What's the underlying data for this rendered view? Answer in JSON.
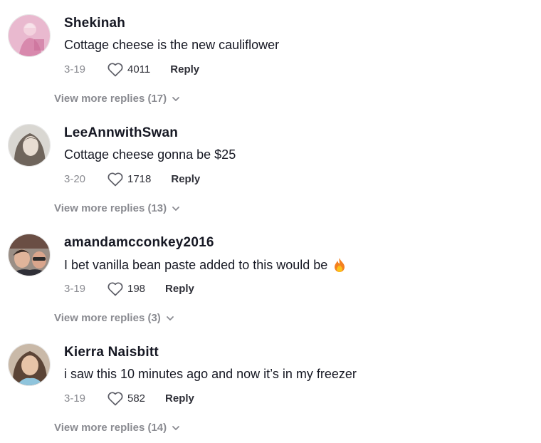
{
  "comments": [
    {
      "username": "Shekinah",
      "text": "Cottage cheese is the new cauliflower",
      "date": "3-19",
      "likes": "4011",
      "reply_label": "Reply",
      "view_more": "View more replies (17)",
      "emoji": ""
    },
    {
      "username": "LeeAnnwithSwan",
      "text": "Cottage cheese gonna be $25",
      "date": "3-20",
      "likes": "1718",
      "reply_label": "Reply",
      "view_more": "View more replies (13)",
      "emoji": ""
    },
    {
      "username": "amandamcconkey2016",
      "text": "I bet vanilla bean paste added to this would be",
      "date": "3-19",
      "likes": "198",
      "reply_label": "Reply",
      "view_more": "View more replies (3)",
      "emoji": "fire-emoji"
    },
    {
      "username": "Kierra Naisbitt",
      "text": "i saw this 10 minutes ago and now it’s in my freezer",
      "date": "3-19",
      "likes": "582",
      "reply_label": "Reply",
      "view_more": "View more replies (14)",
      "emoji": ""
    }
  ],
  "icons": {
    "like": "heart-outline-icon",
    "expand": "chevron-down-icon"
  },
  "colors": {
    "text_primary": "#161823",
    "text_secondary": "#8a8b91",
    "background": "#ffffff"
  }
}
